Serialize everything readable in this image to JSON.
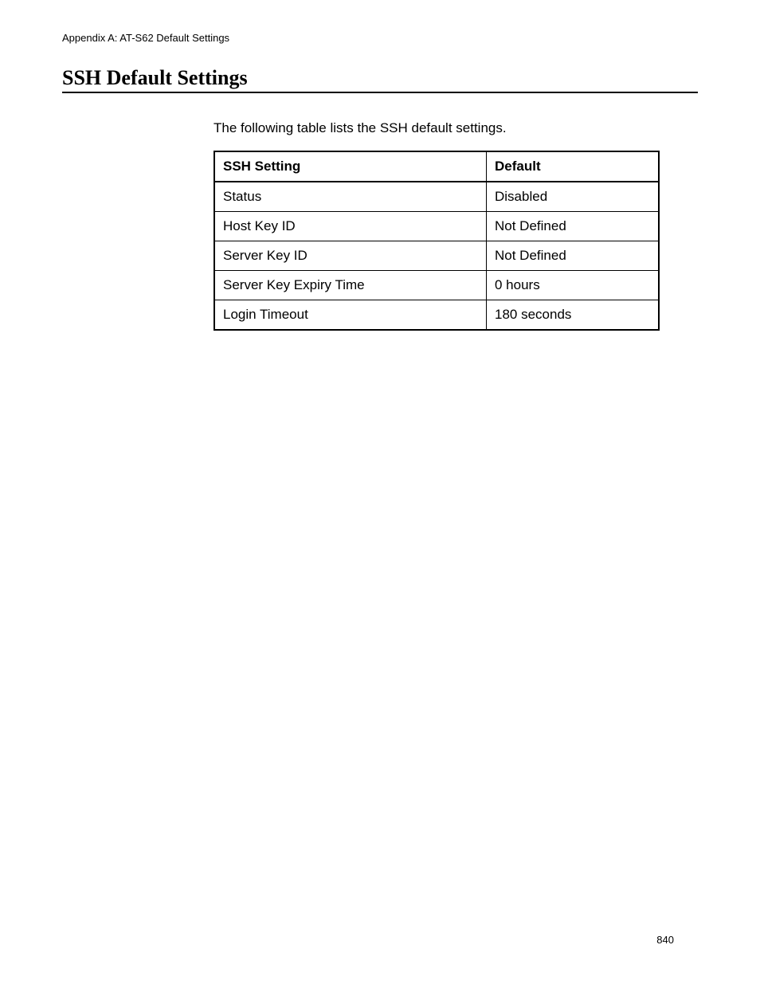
{
  "header": {
    "running_head": "Appendix A: AT-S62 Default Settings"
  },
  "section": {
    "title": "SSH Default Settings",
    "intro": "The following table lists the SSH default settings."
  },
  "table": {
    "headers": {
      "col1": "SSH Setting",
      "col2": "Default"
    },
    "rows": [
      {
        "setting": "Status",
        "default": "Disabled"
      },
      {
        "setting": "Host Key ID",
        "default": "Not Defined"
      },
      {
        "setting": "Server Key ID",
        "default": "Not Defined"
      },
      {
        "setting": "Server Key Expiry Time",
        "default": "0 hours"
      },
      {
        "setting": "Login Timeout",
        "default": "180 seconds"
      }
    ]
  },
  "footer": {
    "page_number": "840"
  }
}
